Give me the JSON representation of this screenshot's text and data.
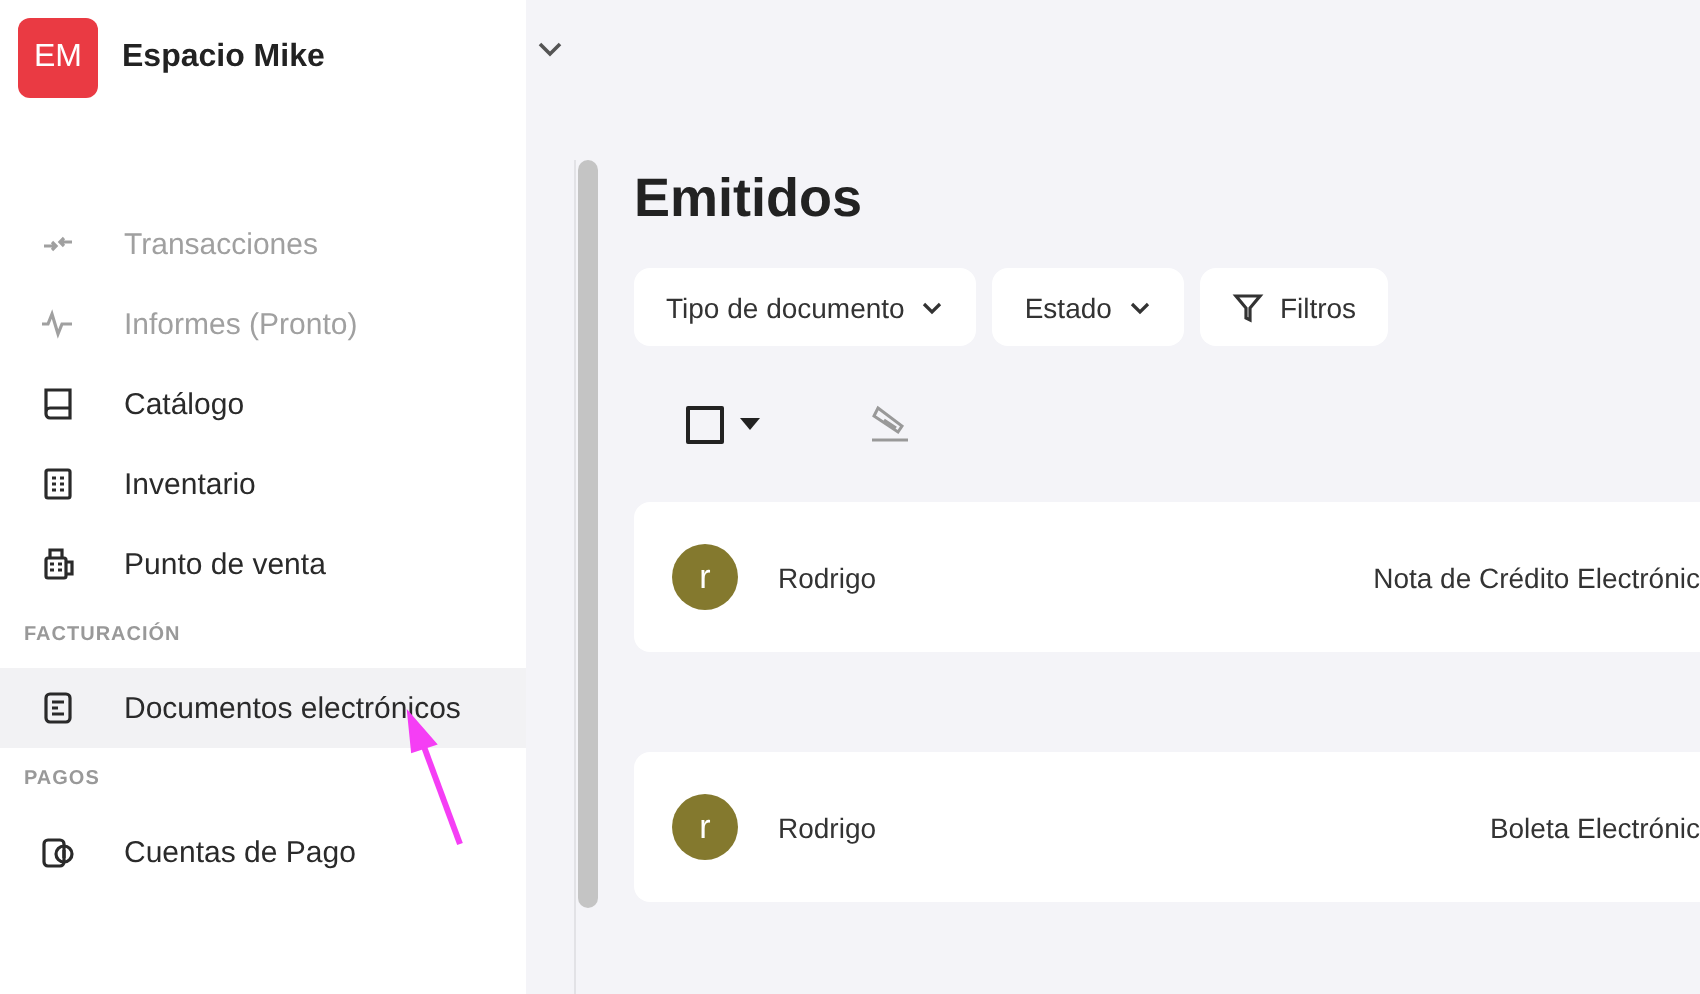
{
  "workspace": {
    "initials": "EM",
    "name": "Espacio Mike"
  },
  "sidebar": {
    "sections": [
      {
        "items": [
          {
            "label": "Transacciones",
            "disabled": true,
            "selected": false
          },
          {
            "label": "Informes (Pronto)",
            "disabled": true,
            "selected": false
          },
          {
            "label": "Catálogo",
            "disabled": false,
            "selected": false
          },
          {
            "label": "Inventario",
            "disabled": false,
            "selected": false
          },
          {
            "label": "Punto de venta",
            "disabled": false,
            "selected": false
          }
        ]
      },
      {
        "heading": "FACTURACIÓN",
        "items": [
          {
            "label": "Documentos electrónicos",
            "disabled": false,
            "selected": true
          }
        ]
      },
      {
        "heading": "PAGOS",
        "items": [
          {
            "label": "Cuentas de Pago",
            "disabled": false,
            "selected": false
          }
        ]
      }
    ]
  },
  "page": {
    "title": "Emitidos",
    "filters": [
      {
        "label": "Tipo de documento",
        "kind": "dropdown"
      },
      {
        "label": "Estado",
        "kind": "dropdown"
      },
      {
        "label": "Filtros",
        "kind": "filter"
      }
    ],
    "select_all": {
      "checked": false
    },
    "rows": [
      {
        "avatar": "r",
        "name": "Rodrigo",
        "document_type": "Nota de Crédito Electrónic"
      },
      {
        "avatar": "r",
        "name": "Rodrigo",
        "document_type": "Boleta Electrónic"
      }
    ]
  }
}
